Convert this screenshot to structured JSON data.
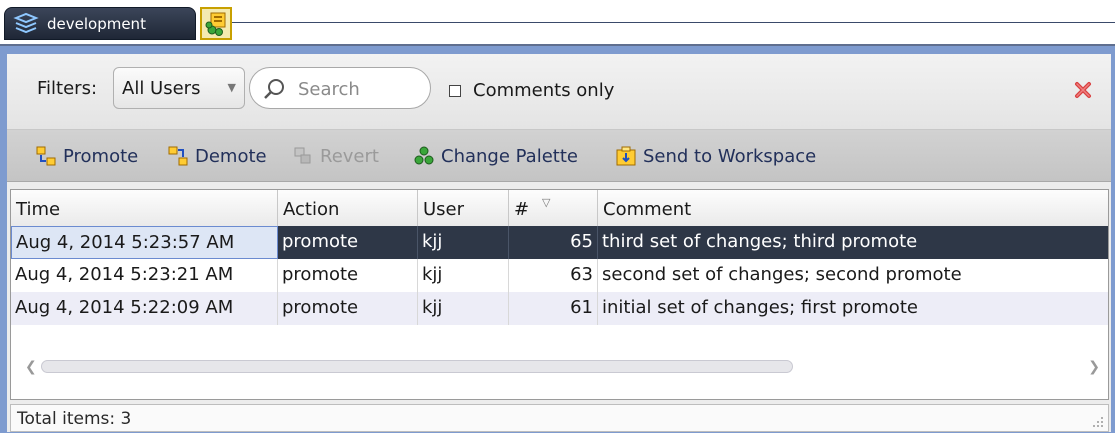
{
  "tabs": [
    {
      "label": "development",
      "icon": "layers-icon"
    },
    {
      "label": "",
      "icon": "change-palette-icon"
    }
  ],
  "filters": {
    "label": "Filters:",
    "user_select": "All Users",
    "search_placeholder": "Search",
    "comments_only_label": "Comments only",
    "comments_only_checked": false
  },
  "toolbar": {
    "promote": "Promote",
    "demote": "Demote",
    "revert": "Revert",
    "change_palette": "Change Palette",
    "send_to_workspace": "Send to Workspace"
  },
  "table": {
    "columns": [
      "Time",
      "Action",
      "User",
      "#",
      "Comment"
    ],
    "sort_column": "#",
    "sort_direction": "descending",
    "rows": [
      {
        "time": "Aug 4, 2014 5:23:57 AM",
        "action": "promote",
        "user": "kjj",
        "num": "65",
        "comment": "third set of changes; third promote",
        "selected": true
      },
      {
        "time": "Aug 4, 2014 5:23:21 AM",
        "action": "promote",
        "user": "kjj",
        "num": "63",
        "comment": "second set of changes; second promote",
        "selected": false
      },
      {
        "time": "Aug 4, 2014 5:22:09 AM",
        "action": "promote",
        "user": "kjj",
        "num": "61",
        "comment": "initial set of changes; first promote",
        "selected": false
      }
    ]
  },
  "status": {
    "total_items": "Total items: 3"
  },
  "colors": {
    "panel_border": "#7e9bcf",
    "selected_row": "#2e3747",
    "tab_dark": "#1f2736",
    "close_red": "#d84040"
  }
}
